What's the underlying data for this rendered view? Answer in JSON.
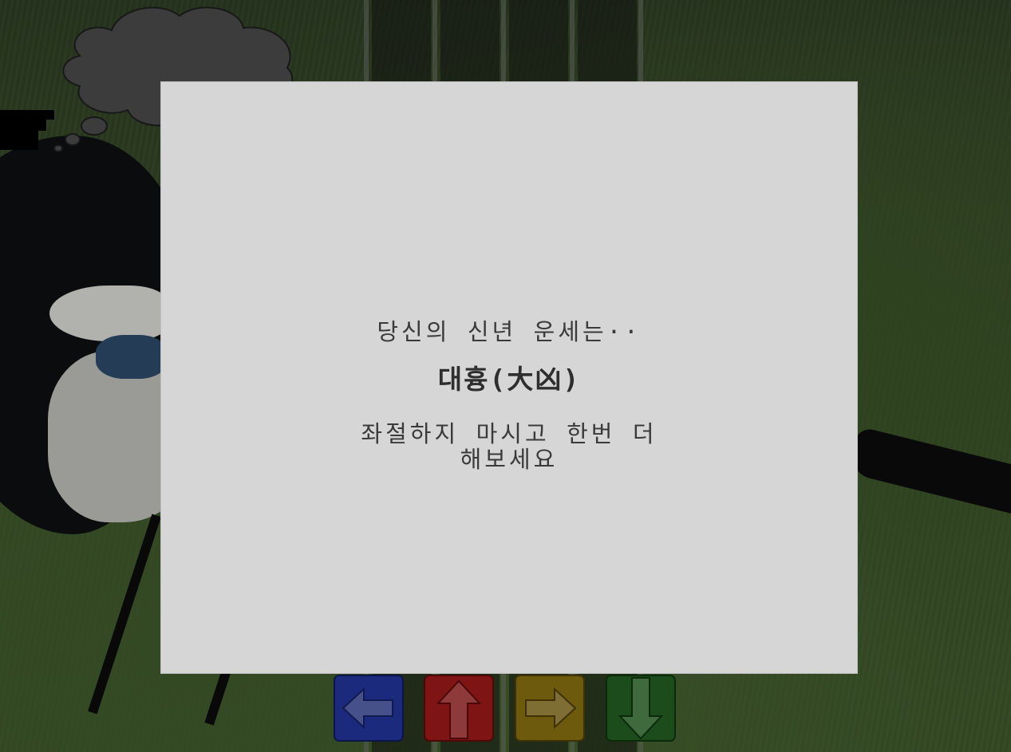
{
  "fortune": {
    "intro": "당신의 신년 운세는··",
    "result": "대흉(大凶)",
    "advice_line1": "좌절하지 마시고 한번 더",
    "advice_line2": "해보세요"
  },
  "controls": {
    "arrows": [
      {
        "icon": "left-arrow-icon",
        "color": "#1c2a7e"
      },
      {
        "icon": "up-arrow-icon",
        "color": "#7e1414"
      },
      {
        "icon": "right-arrow-icon",
        "color": "#6e5a0c"
      },
      {
        "icon": "down-arrow-icon",
        "color": "#1c4c1c"
      }
    ]
  },
  "colors": {
    "dialog_bg": "#d6d6d6",
    "text": "#3a3a3a",
    "bubble": "#4a4a4a"
  }
}
